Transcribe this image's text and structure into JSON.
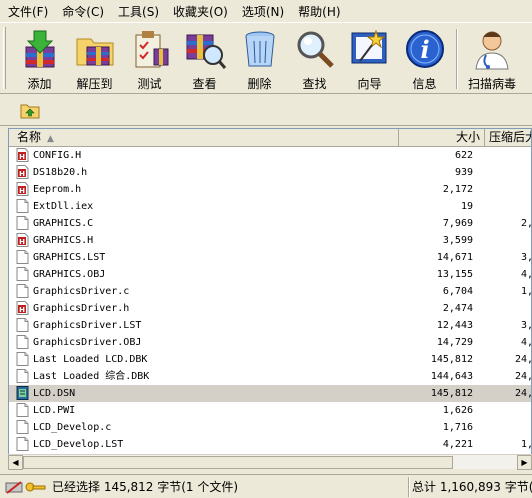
{
  "menu": [
    {
      "label": "文件(F)"
    },
    {
      "label": "命令(C)"
    },
    {
      "label": "工具(S)"
    },
    {
      "label": "收藏夹(O)"
    },
    {
      "label": "选项(N)"
    },
    {
      "label": "帮助(H)"
    }
  ],
  "toolbar": {
    "add": "添加",
    "extract": "解压到",
    "test": "测试",
    "view": "查看",
    "delete": "删除",
    "find": "查找",
    "wizard": "向导",
    "info": "信息",
    "scan": "扫描病毒"
  },
  "list": {
    "headers": {
      "name": "名称",
      "size": "大小",
      "packed": "压缩后大"
    },
    "files": [
      {
        "name": "CONFIG.H",
        "size": "622",
        "packed": "",
        "type": "h"
      },
      {
        "name": "DS18b20.h",
        "size": "939",
        "packed": "",
        "type": "h"
      },
      {
        "name": "Eeprom.h",
        "size": "2,172",
        "packed": "",
        "type": "h"
      },
      {
        "name": "ExtDll.iex",
        "size": "19",
        "packed": "",
        "type": "doc"
      },
      {
        "name": "GRAPHICS.C",
        "size": "7,969",
        "packed": "2,",
        "type": "doc"
      },
      {
        "name": "GRAPHICS.H",
        "size": "3,599",
        "packed": "",
        "type": "h"
      },
      {
        "name": "GRAPHICS.LST",
        "size": "14,671",
        "packed": "3,",
        "type": "doc"
      },
      {
        "name": "GRAPHICS.OBJ",
        "size": "13,155",
        "packed": "4,",
        "type": "doc"
      },
      {
        "name": "GraphicsDriver.c",
        "size": "6,704",
        "packed": "1,",
        "type": "doc"
      },
      {
        "name": "GraphicsDriver.h",
        "size": "2,474",
        "packed": "",
        "type": "h"
      },
      {
        "name": "GraphicsDriver.LST",
        "size": "12,443",
        "packed": "3,",
        "type": "doc"
      },
      {
        "name": "GraphicsDriver.OBJ",
        "size": "14,729",
        "packed": "4,",
        "type": "doc"
      },
      {
        "name": "Last Loaded LCD.DBK",
        "size": "145,812",
        "packed": "24,",
        "type": "doc"
      },
      {
        "name": "Last Loaded 综合.DBK",
        "size": "144,643",
        "packed": "24,",
        "type": "doc"
      },
      {
        "name": "LCD.DSN",
        "size": "145,812",
        "packed": "24,",
        "type": "dsn",
        "selected": true
      },
      {
        "name": "LCD.PWI",
        "size": "1,626",
        "packed": "",
        "type": "doc"
      },
      {
        "name": "LCD_Develop.c",
        "size": "1,716",
        "packed": "",
        "type": "doc"
      },
      {
        "name": "LCD_Develop.LST",
        "size": "4,221",
        "packed": "1,",
        "type": "doc"
      }
    ]
  },
  "status": {
    "left": "已经选择 145,812 字节(1 个文件)",
    "right": "总计 1,160,893 字节(2"
  },
  "colors": {
    "background": "#ece9d8",
    "list_background": "#ffffff",
    "selected_row": "#d4d0c8",
    "border": "#7f9db9"
  }
}
